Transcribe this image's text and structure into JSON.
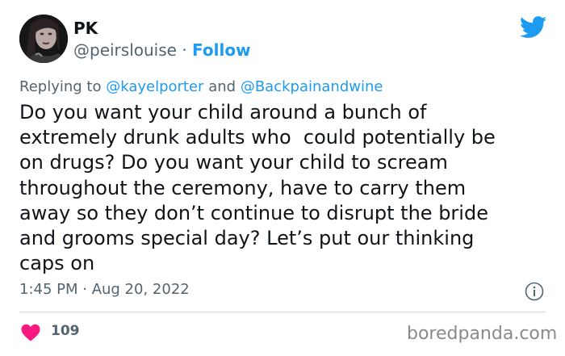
{
  "author": {
    "name": "PK",
    "handle": "@peirslouise",
    "separator": "·",
    "follow_label": "Follow",
    "avatar_icon": "profile-photo"
  },
  "reply": {
    "prefix": "Replying to",
    "mention_1": "@kayelporter",
    "conjunction": "and",
    "mention_2": "@Backpainandwine"
  },
  "tweet": {
    "lines": [
      "Do you want your child around a bunch of",
      "extremely drunk adults who  could potentially be",
      "on drugs? Do you want your child to scream",
      "throughout the ceremony, have to carry them",
      "away so they don’t continue to disrupt the bride",
      "and grooms special day? Let’s put our thinking",
      "caps on"
    ],
    "timestamp": "1:45 PM · Aug 20, 2022",
    "likes": "109"
  },
  "icons": {
    "brand": "twitter-bird-icon",
    "info": "info-icon",
    "like": "heart-icon"
  },
  "colors": {
    "accent": "#1d9bf0",
    "heart": "#f91880",
    "secondary_text": "#536471",
    "divider": "#cfd9de"
  },
  "watermark": "boredpanda.com"
}
